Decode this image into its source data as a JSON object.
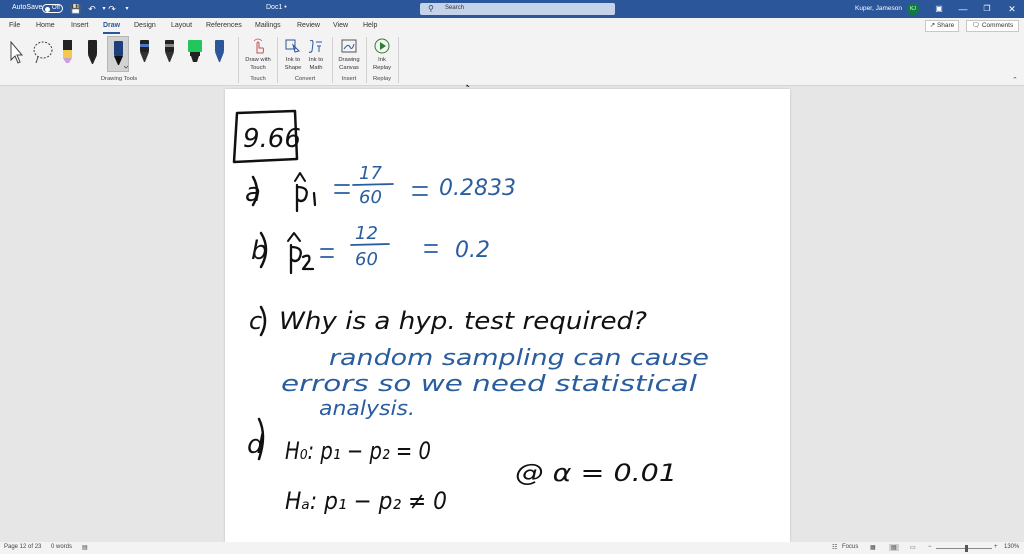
{
  "titlebar": {
    "autosave_label": "AutoSave",
    "autosave_state": "Off",
    "doc_title": "Doc1 •",
    "search_placeholder": "Search",
    "user_name": "Kuper, Jameson",
    "user_initials": "KJ"
  },
  "menu": {
    "tabs": [
      "File",
      "Home",
      "Insert",
      "Draw",
      "Design",
      "Layout",
      "References",
      "Mailings",
      "Review",
      "View",
      "Help"
    ],
    "active_tab": "Draw",
    "share_label": "Share",
    "comments_label": "Comments"
  },
  "ribbon": {
    "groups": {
      "drawing_tools": "Drawing Tools",
      "touch": "Touch",
      "convert": "Convert",
      "insert": "Insert",
      "replay": "Replay"
    },
    "buttons": {
      "draw_with_touch": [
        "Draw with",
        "Touch"
      ],
      "ink_to_shape": [
        "Ink to",
        "Shape"
      ],
      "ink_to_math": [
        "Ink to",
        "Math"
      ],
      "drawing_canvas": [
        "Drawing",
        "Canvas"
      ],
      "ink_replay": [
        "Ink",
        "Replay"
      ]
    },
    "pen_colors": [
      "#000000",
      "#1f3f7a",
      "#000000",
      "#2e7d32",
      "#000000",
      "#22c55e",
      "#2b579a"
    ]
  },
  "document": {
    "problem_number": "9.66",
    "part_a": {
      "label": "a)",
      "expr": "p̂₁ = 17/60 = 0.2833",
      "numerator": "17",
      "denominator": "60",
      "result": "0.2833"
    },
    "part_b": {
      "label": "b)",
      "expr": "p̂₂ = 12/60 = 0.2",
      "numerator": "12",
      "denominator": "60",
      "result": "0.2"
    },
    "part_c": {
      "label": "c)",
      "question": "Why is a hyp. test required?",
      "answer_lines": [
        "random sampling can cause",
        "errors so we need statistical",
        "analysis."
      ]
    },
    "part_d": {
      "label": "d)",
      "h0": "H₀: p₁ − p₂ = 0",
      "ha": "Hₐ: p₁ − p₂ ≠ 0",
      "alpha_note": "@ α = 0.01"
    },
    "ink_colors": {
      "black": "#111111",
      "blue": "#2a5d9f"
    }
  },
  "status": {
    "page": "Page 12 of 23",
    "words": "0 words",
    "focus": "Focus",
    "zoom": "130%"
  }
}
